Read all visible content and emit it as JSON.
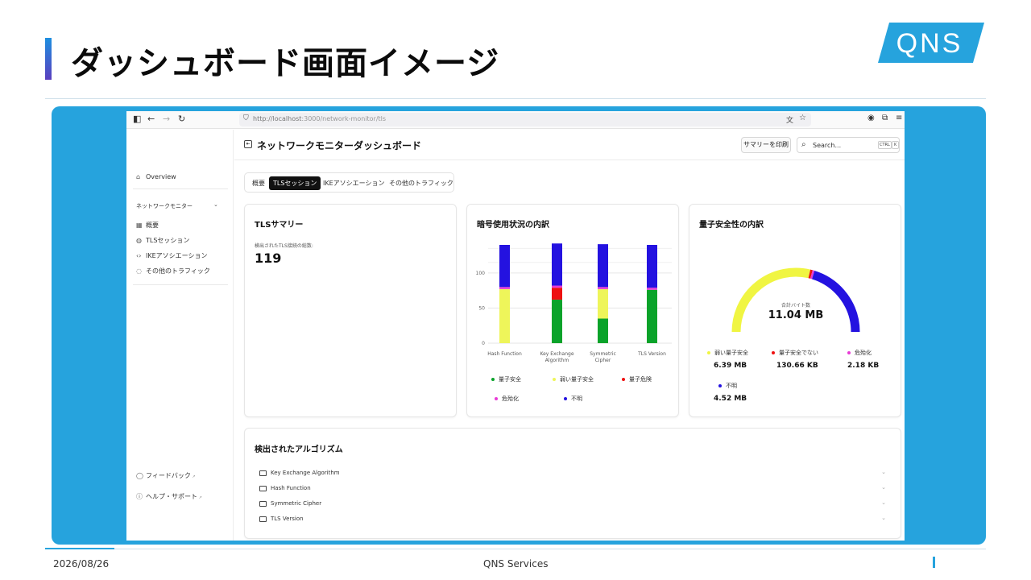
{
  "slide": {
    "title": "ダッシュボード画面イメージ",
    "logo_text": "QNS",
    "footer_date": "2026/08/26",
    "footer_center": "QNS Services"
  },
  "browser": {
    "url_host": "http://localhost",
    "url_path": ":3000/network-monitor/tls"
  },
  "sidebar": {
    "overview": "Overview",
    "section": "ネットワークモニター",
    "items": [
      "概要",
      "TLSセッション",
      "IKEアソシエーション",
      "その他のトラフィック"
    ],
    "feedback": "フィードバック",
    "help": "ヘルプ・サポート"
  },
  "header": {
    "title": "ネットワークモニターダッシュボード",
    "print_label": "サマリーを印刷",
    "search_placeholder": "Search...",
    "shortcut_ctrl": "CTRL",
    "shortcut_k": "K"
  },
  "tabs": [
    "概要",
    "TLSセッション",
    "IKEアソシエーション",
    "その他のトラフィック"
  ],
  "tls_summary": {
    "title": "TLSサマリー",
    "label": "検出されたTLS接続の総数:",
    "value": "119"
  },
  "crypto_card": {
    "title": "暗号使用状況の内訳"
  },
  "quantum_card": {
    "title": "量子安全性の内訳",
    "center_label": "合計バイト数",
    "center_value": "11.04 MB",
    "legend": [
      {
        "name": "弱い量子安全",
        "value": "6.39 MB",
        "color": "#f0f542"
      },
      {
        "name": "量子安全でない",
        "value": "130.66 KB",
        "color": "#ee1111"
      },
      {
        "name": "危殆化",
        "value": "2.18 KB",
        "color": "#e83ad6"
      },
      {
        "name": "不明",
        "value": "4.52 MB",
        "color": "#2412e0"
      }
    ]
  },
  "algorithms": {
    "title": "検出されたアルゴリズム",
    "rows": [
      "Key Exchange Algorithm",
      "Hash Function",
      "Symmetric Cipher",
      "TLS Version"
    ]
  },
  "chart_data": [
    {
      "type": "bar",
      "stacked": true,
      "categories": [
        "Hash Function",
        "Key Exchange Algorithm",
        "Symmetric Cipher",
        "TLS Version"
      ],
      "category_lines": [
        [
          "Hash Function"
        ],
        [
          "Key Exchange",
          "Algorithm"
        ],
        [
          "Symmetric",
          "Cipher"
        ],
        [
          "TLS Version"
        ]
      ],
      "yticks": [
        0,
        50,
        100
      ],
      "ylim": [
        0,
        140
      ],
      "series": [
        {
          "name": "量子安全",
          "color": "#0aa32a",
          "values": [
            0,
            62,
            35,
            76
          ]
        },
        {
          "name": "弱い量子安全",
          "color": "#eef55a",
          "values": [
            77,
            0,
            42,
            0
          ]
        },
        {
          "name": "量子危険",
          "color": "#ee1111",
          "values": [
            0,
            17,
            0,
            0
          ]
        },
        {
          "name": "危殆化",
          "color": "#e83ad6",
          "values": [
            3,
            3,
            3,
            3
          ]
        },
        {
          "name": "不明",
          "color": "#2412e0",
          "values": [
            60,
            60,
            61,
            61
          ]
        }
      ],
      "legend_placement": "bottom",
      "grid": true
    },
    {
      "type": "pie",
      "variant": "half-donut",
      "title": "量子安全性の内訳",
      "labels": [
        "弱い量子安全",
        "量子安全でない",
        "危殆化",
        "不明"
      ],
      "values_bytes": [
        6390000,
        130660,
        2180,
        4520000
      ],
      "colors": [
        "#f0f542",
        "#ee1111",
        "#e83ad6",
        "#2412e0"
      ]
    }
  ]
}
